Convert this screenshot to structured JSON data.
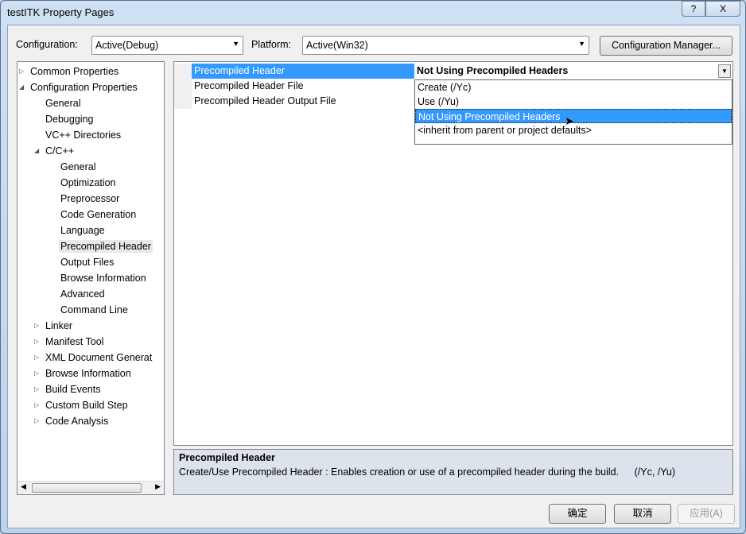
{
  "window": {
    "title": "testITK Property Pages",
    "help_label": "?",
    "close_label": "X"
  },
  "toolbar": {
    "configuration_label": "Configuration:",
    "configuration_value": "Active(Debug)",
    "platform_label": "Platform:",
    "platform_value": "Active(Win32)",
    "config_manager_label": "Configuration Manager..."
  },
  "tree": [
    {
      "label": "Common Properties",
      "level": 0,
      "expander": "collapsed"
    },
    {
      "label": "Configuration Properties",
      "level": 0,
      "expander": "expanded"
    },
    {
      "label": "General",
      "level": 1
    },
    {
      "label": "Debugging",
      "level": 1
    },
    {
      "label": "VC++ Directories",
      "level": 1
    },
    {
      "label": "C/C++",
      "level": 1,
      "expander": "expanded"
    },
    {
      "label": "General",
      "level": 2
    },
    {
      "label": "Optimization",
      "level": 2
    },
    {
      "label": "Preprocessor",
      "level": 2
    },
    {
      "label": "Code Generation",
      "level": 2
    },
    {
      "label": "Language",
      "level": 2
    },
    {
      "label": "Precompiled Header",
      "level": 2,
      "selected": true
    },
    {
      "label": "Output Files",
      "level": 2
    },
    {
      "label": "Browse Information",
      "level": 2
    },
    {
      "label": "Advanced",
      "level": 2
    },
    {
      "label": "Command Line",
      "level": 2
    },
    {
      "label": "Linker",
      "level": 1,
      "expander": "collapsed"
    },
    {
      "label": "Manifest Tool",
      "level": 1,
      "expander": "collapsed"
    },
    {
      "label": "XML Document Generat",
      "level": 1,
      "expander": "collapsed"
    },
    {
      "label": "Browse Information",
      "level": 1,
      "expander": "collapsed"
    },
    {
      "label": "Build Events",
      "level": 1,
      "expander": "collapsed"
    },
    {
      "label": "Custom Build Step",
      "level": 1,
      "expander": "collapsed"
    },
    {
      "label": "Code Analysis",
      "level": 1,
      "expander": "collapsed"
    }
  ],
  "grid": {
    "rows": [
      {
        "name": "Precompiled Header",
        "value": "Not Using Precompiled Headers"
      },
      {
        "name": "Precompiled Header File",
        "value": ""
      },
      {
        "name": "Precompiled Header Output File",
        "value": ""
      }
    ],
    "dropdown_options": [
      "Create (/Yc)",
      "Use (/Yu)",
      "Not Using Precompiled Headers",
      "<inherit from parent or project defaults>"
    ],
    "highlighted_option": 2
  },
  "description": {
    "title": "Precompiled Header",
    "text": "Create/Use Precompiled Header : Enables creation or use of a precompiled header during the build.",
    "switches": "(/Yc, /Yu)"
  },
  "buttons": {
    "ok": "确定",
    "cancel": "取消",
    "apply": "应用(A)"
  },
  "colors": {
    "selection": "#3399ff"
  }
}
